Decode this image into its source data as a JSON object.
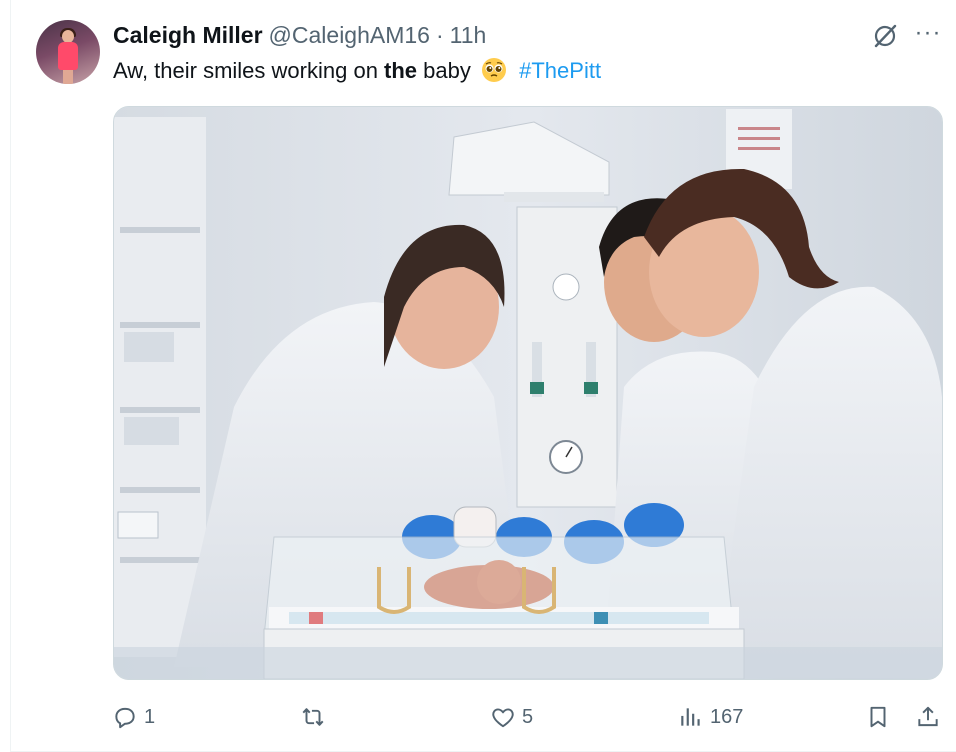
{
  "tweet": {
    "author_name": "Caleigh Miller",
    "handle": "@CaleighAM16",
    "separator": "·",
    "time": "11h",
    "text_before": "Aw, their smiles working on ",
    "text_bold": "the",
    "text_after": " baby",
    "emoji": "pleading-face-emoji",
    "hashtag": "#ThePitt",
    "media_subject": "photo"
  },
  "actions": {
    "replies": "1",
    "reposts": "",
    "likes": "5",
    "views": "167"
  },
  "colors": {
    "accent": "#1d9bf0",
    "secondary_text": "#536471",
    "border": "#eff3f4"
  },
  "icons": [
    "grok-icon",
    "more-icon",
    "reply-icon",
    "repost-icon",
    "like-icon",
    "views-icon",
    "bookmark-icon",
    "share-icon"
  ]
}
